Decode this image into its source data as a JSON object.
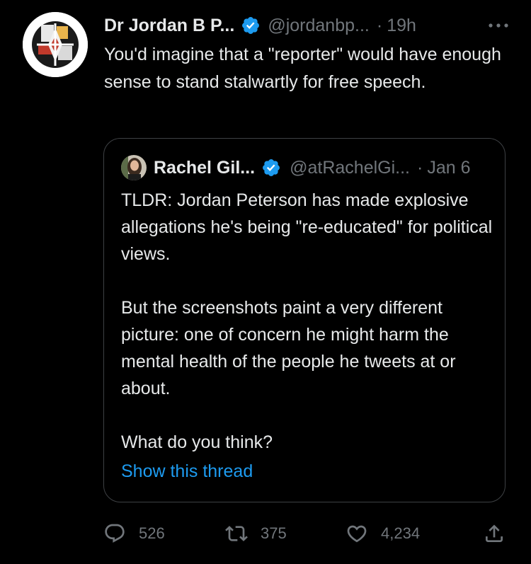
{
  "tweet": {
    "display_name": "Dr Jordan B P...",
    "handle": "@jordanbp...",
    "separator": "·",
    "time": "19h",
    "text": "You'd imagine that a \"reporter\" would have enough sense to stand stalwartly for free speech.",
    "avatar_icon": "logo-avatar-icon",
    "verified_icon": "verified-badge-icon",
    "more_icon": "more-options-icon"
  },
  "quote": {
    "display_name": "Rachel Gil...",
    "handle": "@atRachelGi...",
    "separator": "·",
    "time": "Jan 6",
    "text": "TLDR: Jordan Peterson has made explosive allegations he's being \"re-educated\" for political views.\n\nBut the screenshots paint a very different picture: one of concern he might harm the mental health of the people he tweets at or about.\n\nWhat do you think?",
    "show_thread_label": "Show this thread"
  },
  "actions": {
    "replies": "526",
    "retweets": "375",
    "likes": "4,234"
  },
  "colors": {
    "background": "#000000",
    "primary_text": "#e7e9ea",
    "secondary_text": "#71767b",
    "accent": "#1d9bf0",
    "border": "#3e4144"
  }
}
